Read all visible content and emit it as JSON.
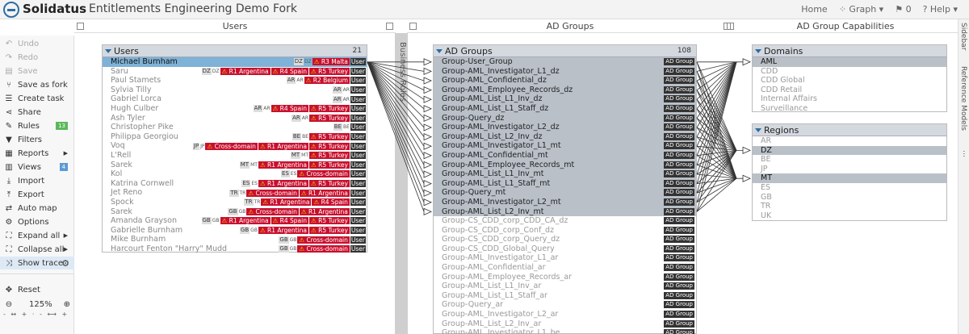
{
  "app": {
    "brand": "Solidatus",
    "title": "Entitlements Engineering Demo Fork"
  },
  "nav": {
    "home": "Home",
    "graph": "Graph ▾",
    "flags": "0",
    "help": "? Help ▾"
  },
  "columns": {
    "users": "Users",
    "ad_groups": "AD Groups",
    "capabilities": "AD Group Capabilities",
    "business_roles": "Business Roles"
  },
  "sidebar_tabs": {
    "sidebar": "Sidebar",
    "reference_models": "Reference Models"
  },
  "toolbar": [
    {
      "label": "Undo",
      "icon": "↶",
      "disabled": true
    },
    {
      "label": "Redo",
      "icon": "↷",
      "disabled": true
    },
    {
      "label": "Save",
      "icon": "▤",
      "disabled": true
    },
    {
      "label": "Save as fork",
      "icon": "⑂"
    },
    {
      "label": "Create task",
      "icon": "☰"
    },
    {
      "label": "Share",
      "icon": "⋖"
    },
    {
      "label": "Rules",
      "icon": "✎",
      "badge": "13"
    },
    {
      "label": "Filters",
      "icon": "▼"
    },
    {
      "label": "Reports",
      "icon": "▦",
      "arrow": true
    },
    {
      "label": "Views",
      "icon": "▥",
      "badge": "4"
    },
    {
      "label": "Import",
      "icon": "⤓"
    },
    {
      "label": "Export",
      "icon": "⤒"
    },
    {
      "label": "Auto map",
      "icon": "⇄"
    },
    {
      "label": "Options",
      "icon": "⚙"
    },
    {
      "label": "Expand all",
      "icon": "⛶",
      "arrow": true
    },
    {
      "label": "Collapse all",
      "icon": "⛶",
      "arrow": true
    },
    {
      "label": "Show trace",
      "icon": "⤨",
      "active": true,
      "gear": true
    }
  ],
  "reset": "Reset",
  "zoom": "125%",
  "users": {
    "title": "Users",
    "count": "21",
    "rows": [
      {
        "name": "Michael Burnham",
        "sel": true,
        "codes": [
          "DZ"
        ],
        "risks": [
          "R3 Malta"
        ]
      },
      {
        "name": "Saru",
        "codes": [
          "DZ"
        ],
        "risks": [
          "R1 Argentina",
          "R4 Spain",
          "R5 Turkey"
        ]
      },
      {
        "name": "Paul Stamets",
        "codes": [
          "AR"
        ],
        "risks": [
          "R2 Belgium"
        ]
      },
      {
        "name": "Sylvia Tilly",
        "codes": [
          "AR"
        ],
        "risks": []
      },
      {
        "name": "Gabriel Lorca",
        "codes": [
          "AR"
        ],
        "risks": []
      },
      {
        "name": "Hugh Culber",
        "codes": [
          "AR"
        ],
        "risks": [
          "R4 Spain",
          "R5 Turkey"
        ]
      },
      {
        "name": "Ash Tyler",
        "codes": [
          "AR"
        ],
        "risks": [
          "R5 Turkey"
        ]
      },
      {
        "name": "Christopher Pike",
        "codes": [
          "BE"
        ],
        "risks": []
      },
      {
        "name": "Philippa Georgiou",
        "codes": [
          "BE"
        ],
        "risks": [
          "R5 Turkey"
        ]
      },
      {
        "name": "Voq",
        "codes": [
          "JP"
        ],
        "risks": [
          "Cross-domain",
          "R1 Argentina",
          "R5 Turkey"
        ]
      },
      {
        "name": "L'Rell",
        "codes": [
          "MT"
        ],
        "risks": [
          "R5 Turkey"
        ]
      },
      {
        "name": "Sarek",
        "codes": [
          "MT"
        ],
        "risks": [
          "R1 Argentina",
          "R5 Turkey"
        ]
      },
      {
        "name": "Kol",
        "codes": [
          "ES"
        ],
        "risks": [
          "Cross-domain"
        ]
      },
      {
        "name": "Katrina Cornwell",
        "codes": [
          "ES"
        ],
        "risks": [
          "R1 Argentina",
          "R5 Turkey"
        ]
      },
      {
        "name": "Jet Reno",
        "codes": [
          "TR"
        ],
        "risks": [
          "Cross-domain",
          "R1 Argentina"
        ]
      },
      {
        "name": "Spock",
        "codes": [
          "TR"
        ],
        "risks": [
          "R1 Argentina",
          "R4 Spain"
        ]
      },
      {
        "name": "Sarek",
        "codes": [
          "GB"
        ],
        "risks": [
          "Cross-domain",
          "R1 Argentina"
        ]
      },
      {
        "name": "Amanda Grayson",
        "codes": [
          "GB"
        ],
        "risks": [
          "R1 Argentina",
          "R4 Spain",
          "R5 Turkey"
        ]
      },
      {
        "name": "Gabrielle Burnham",
        "codes": [
          "GB"
        ],
        "risks": [
          "R1 Argentina",
          "R5 Turkey"
        ]
      },
      {
        "name": "Mike Burnham",
        "codes": [
          "GB"
        ],
        "risks": [
          "Cross-domain"
        ]
      },
      {
        "name": "Harcourt Fenton \"Harry\" Mudd",
        "codes": [
          "GB"
        ],
        "risks": [
          "Cross-domain"
        ]
      }
    ]
  },
  "ad_groups": {
    "title": "AD Groups",
    "count": "108",
    "tag": "AD Group",
    "rows": [
      {
        "name": "Group-User_Group",
        "hl": true
      },
      {
        "name": "Group-AML_Investigator_L1_dz",
        "hl": true
      },
      {
        "name": "Group-AML_Confidential_dz",
        "hl": true
      },
      {
        "name": "Group-AML_Employee_Records_dz",
        "hl": true
      },
      {
        "name": "Group-AML_List_L1_Inv_dz",
        "hl": true
      },
      {
        "name": "Group-AML_List_L1_Staff_dz",
        "hl": true
      },
      {
        "name": "Group-Query_dz",
        "hl": true
      },
      {
        "name": "Group-AML_Investigator_L2_dz",
        "hl": true
      },
      {
        "name": "Group-AML_List_L2_Inv_dz",
        "hl": true
      },
      {
        "name": "Group-AML_Investigator_L1_mt",
        "hl": true
      },
      {
        "name": "Group-AML_Confidential_mt",
        "hl": true
      },
      {
        "name": "Group-AML_Employee_Records_mt",
        "hl": true
      },
      {
        "name": "Group-AML_List_L1_Inv_mt",
        "hl": true
      },
      {
        "name": "Group-AML_List_L1_Staff_mt",
        "hl": true
      },
      {
        "name": "Group-Query_mt",
        "hl": true
      },
      {
        "name": "Group-AML_Investigator_L2_mt",
        "hl": true
      },
      {
        "name": "Group-AML_List_L2_Inv_mt",
        "hl": true
      },
      {
        "name": "Group-CS_CDD_corp_CDD_CA_dz"
      },
      {
        "name": "Group-CS_CDD_corp_Conf_dz"
      },
      {
        "name": "Group-CS_CDD_corp_Query_dz"
      },
      {
        "name": "Group-CS_CDD_Global_Query"
      },
      {
        "name": "Group-AML_Investigator_L1_ar"
      },
      {
        "name": "Group-AML_Confidential_ar"
      },
      {
        "name": "Group-AML_Employee_Records_ar"
      },
      {
        "name": "Group-AML_List_L1_Inv_ar"
      },
      {
        "name": "Group-AML_List_L1_Staff_ar"
      },
      {
        "name": "Group-Query_ar"
      },
      {
        "name": "Group-AML_Investigator_L2_ar"
      },
      {
        "name": "Group-AML_List_L2_Inv_ar"
      },
      {
        "name": "Group-AML_Investigator_L1_be"
      }
    ]
  },
  "domains": {
    "title": "Domains",
    "rows": [
      {
        "name": "AML",
        "sel": true
      },
      {
        "name": "CDD"
      },
      {
        "name": "CDD Global"
      },
      {
        "name": "CDD Retail"
      },
      {
        "name": "Internal Affairs"
      },
      {
        "name": "Surveillance"
      }
    ]
  },
  "regions": {
    "title": "Regions",
    "rows": [
      {
        "name": "AR"
      },
      {
        "name": "DZ",
        "sel": true
      },
      {
        "name": "BE"
      },
      {
        "name": "JP"
      },
      {
        "name": "MT",
        "sel": true
      },
      {
        "name": "ES"
      },
      {
        "name": "GB"
      },
      {
        "name": "TR"
      },
      {
        "name": "UK"
      }
    ]
  }
}
